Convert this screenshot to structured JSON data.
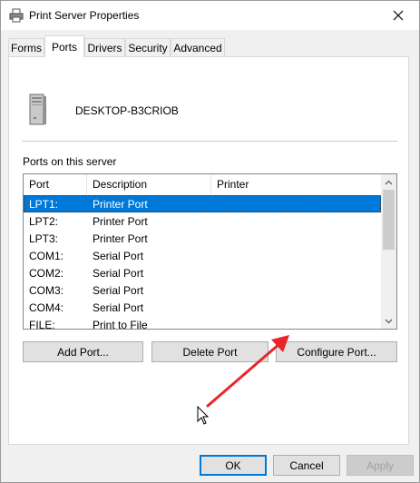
{
  "window": {
    "title": "Print Server Properties",
    "icon": "printer-icon"
  },
  "tabs": [
    {
      "label": "Forms",
      "active": false
    },
    {
      "label": "Ports",
      "active": true
    },
    {
      "label": "Drivers",
      "active": false
    },
    {
      "label": "Security",
      "active": false
    },
    {
      "label": "Advanced",
      "active": false
    }
  ],
  "server": {
    "icon": "computer-tower-icon",
    "name": "DESKTOP-B3CRIOB"
  },
  "ports": {
    "label": "Ports on this server",
    "columns": [
      "Port",
      "Description",
      "Printer"
    ],
    "rows": [
      {
        "port": "LPT1:",
        "description": "Printer Port",
        "printer": "",
        "selected": true
      },
      {
        "port": "LPT2:",
        "description": "Printer Port",
        "printer": ""
      },
      {
        "port": "LPT3:",
        "description": "Printer Port",
        "printer": ""
      },
      {
        "port": "COM1:",
        "description": "Serial Port",
        "printer": ""
      },
      {
        "port": "COM2:",
        "description": "Serial Port",
        "printer": ""
      },
      {
        "port": "COM3:",
        "description": "Serial Port",
        "printer": ""
      },
      {
        "port": "COM4:",
        "description": "Serial Port",
        "printer": ""
      },
      {
        "port": "FILE:",
        "description": "Print to File",
        "printer": ""
      }
    ]
  },
  "actions": {
    "add_port": "Add Port...",
    "delete_port": "Delete Port",
    "configure_port": "Configure Port..."
  },
  "footer": {
    "ok": "OK",
    "cancel": "Cancel",
    "apply": "Apply"
  },
  "colors": {
    "selection": "#0078d7",
    "annotation_arrow": "#e8262a"
  }
}
